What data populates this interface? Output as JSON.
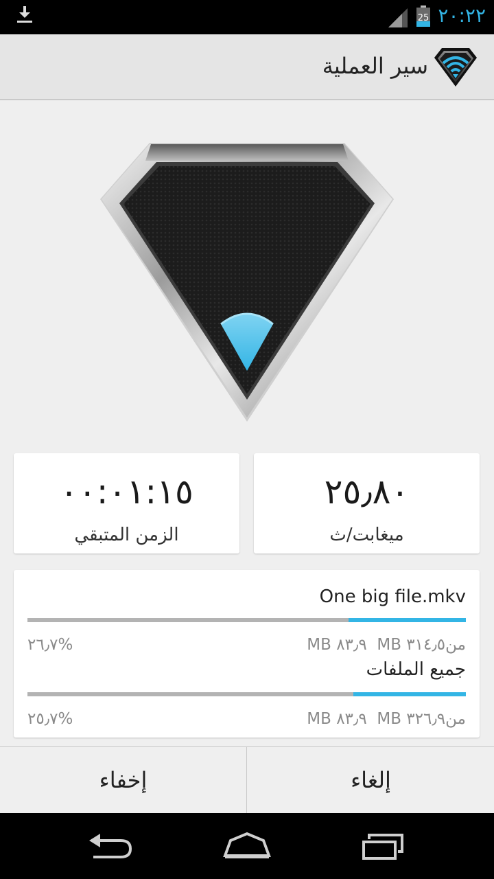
{
  "status_bar": {
    "time": "٢٠:٢٢",
    "battery_level": "25",
    "icons": [
      "download-icon",
      "signal-icon",
      "battery-icon"
    ]
  },
  "action_bar": {
    "title": "سير العملية",
    "icon": "superbeam-wifi-icon"
  },
  "hero": {
    "icon": "diamond-wifi-logo"
  },
  "stats": {
    "speed": {
      "value": "٢٥٫٨٠",
      "label": "ميغابت/ث"
    },
    "time_remaining": {
      "value": "٠٠:٠١:١٥",
      "label": "الزمن المتبقي"
    }
  },
  "transfer": {
    "current_file": {
      "name": "One big file.mkv",
      "transferred": "٨٣٫٩ MB",
      "total": "من٣١٤٫٥ MB",
      "percent": "%٢٦٫٧",
      "progress": 0.267
    },
    "all_files": {
      "label": "جميع الملفات",
      "transferred": "٨٣٫٩ MB",
      "total": "من٣٢٦٫٩ MB",
      "percent": "%٢٥٫٧",
      "progress": 0.257
    }
  },
  "buttons": {
    "hide": "إخفاء",
    "cancel": "إلغاء"
  },
  "nav_bar": {
    "icons": [
      "back-icon",
      "home-icon",
      "recent-apps-icon"
    ]
  },
  "colors": {
    "accent": "#33b5e5",
    "background": "#efefef",
    "track": "#b3b3b3"
  }
}
